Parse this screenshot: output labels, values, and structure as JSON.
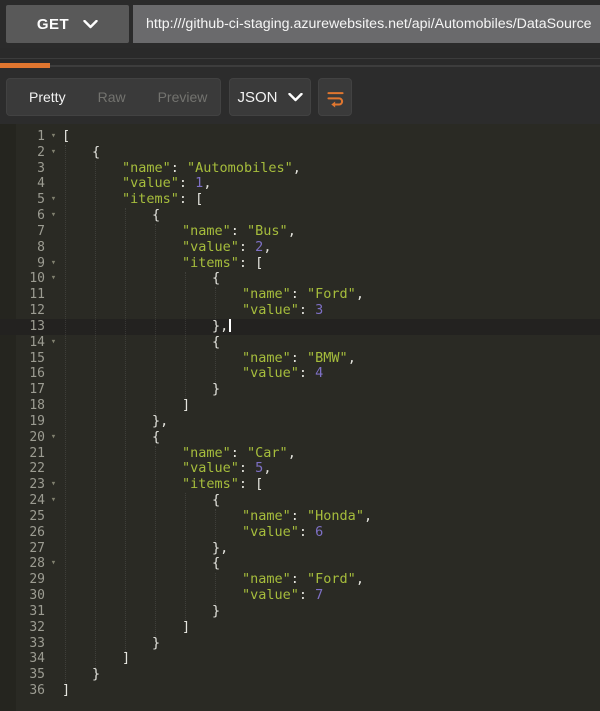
{
  "request_bar": {
    "method": "GET",
    "url": "http:///github-ci-staging.azurewebsites.net/api/Automobiles/DataSource"
  },
  "response_tabs": {
    "pretty": "Pretty",
    "raw": "Raw",
    "preview": "Preview",
    "format": "JSON"
  },
  "colors": {
    "accent_orange": "#e0762f",
    "string_green": "#a6bd3c",
    "number_purple": "#7e70c5",
    "punctuation": "#e4e4de",
    "editor_bg": "#2a2a24",
    "current_line_bg": "#232220",
    "line_number_gray": "#9c9c92"
  },
  "editor": {
    "cursor_line": 13,
    "lines": [
      {
        "n": 1,
        "fold": true,
        "level": 0,
        "tokens": [
          [
            "p",
            "["
          ]
        ]
      },
      {
        "n": 2,
        "fold": true,
        "level": 1,
        "tokens": [
          [
            "p",
            "{"
          ]
        ]
      },
      {
        "n": 3,
        "fold": false,
        "level": 2,
        "tokens": [
          [
            "g",
            "\"name\""
          ],
          [
            "p",
            ": "
          ],
          [
            "g",
            "\"Automobiles\""
          ],
          [
            "p",
            ","
          ]
        ]
      },
      {
        "n": 4,
        "fold": false,
        "level": 2,
        "tokens": [
          [
            "g",
            "\"value\""
          ],
          [
            "p",
            ": "
          ],
          [
            "n",
            "1"
          ],
          [
            "p",
            ","
          ]
        ]
      },
      {
        "n": 5,
        "fold": true,
        "level": 2,
        "tokens": [
          [
            "g",
            "\"items\""
          ],
          [
            "p",
            ": ["
          ]
        ]
      },
      {
        "n": 6,
        "fold": true,
        "level": 3,
        "tokens": [
          [
            "p",
            "{"
          ]
        ]
      },
      {
        "n": 7,
        "fold": false,
        "level": 4,
        "tokens": [
          [
            "g",
            "\"name\""
          ],
          [
            "p",
            ": "
          ],
          [
            "g",
            "\"Bus\""
          ],
          [
            "p",
            ","
          ]
        ]
      },
      {
        "n": 8,
        "fold": false,
        "level": 4,
        "tokens": [
          [
            "g",
            "\"value\""
          ],
          [
            "p",
            ": "
          ],
          [
            "n",
            "2"
          ],
          [
            "p",
            ","
          ]
        ]
      },
      {
        "n": 9,
        "fold": true,
        "level": 4,
        "tokens": [
          [
            "g",
            "\"items\""
          ],
          [
            "p",
            ": ["
          ]
        ]
      },
      {
        "n": 10,
        "fold": true,
        "level": 5,
        "tokens": [
          [
            "p",
            "{"
          ]
        ]
      },
      {
        "n": 11,
        "fold": false,
        "level": 6,
        "tokens": [
          [
            "g",
            "\"name\""
          ],
          [
            "p",
            ": "
          ],
          [
            "g",
            "\"Ford\""
          ],
          [
            "p",
            ","
          ]
        ]
      },
      {
        "n": 12,
        "fold": false,
        "level": 6,
        "tokens": [
          [
            "g",
            "\"value\""
          ],
          [
            "p",
            ": "
          ],
          [
            "n",
            "3"
          ]
        ]
      },
      {
        "n": 13,
        "fold": false,
        "level": 5,
        "tokens": [
          [
            "p",
            "},"
          ]
        ]
      },
      {
        "n": 14,
        "fold": true,
        "level": 5,
        "tokens": [
          [
            "p",
            "{"
          ]
        ]
      },
      {
        "n": 15,
        "fold": false,
        "level": 6,
        "tokens": [
          [
            "g",
            "\"name\""
          ],
          [
            "p",
            ": "
          ],
          [
            "g",
            "\"BMW\""
          ],
          [
            "p",
            ","
          ]
        ]
      },
      {
        "n": 16,
        "fold": false,
        "level": 6,
        "tokens": [
          [
            "g",
            "\"value\""
          ],
          [
            "p",
            ": "
          ],
          [
            "n",
            "4"
          ]
        ]
      },
      {
        "n": 17,
        "fold": false,
        "level": 5,
        "tokens": [
          [
            "p",
            "}"
          ]
        ]
      },
      {
        "n": 18,
        "fold": false,
        "level": 4,
        "tokens": [
          [
            "p",
            "]"
          ]
        ]
      },
      {
        "n": 19,
        "fold": false,
        "level": 3,
        "tokens": [
          [
            "p",
            "},"
          ]
        ]
      },
      {
        "n": 20,
        "fold": true,
        "level": 3,
        "tokens": [
          [
            "p",
            "{"
          ]
        ]
      },
      {
        "n": 21,
        "fold": false,
        "level": 4,
        "tokens": [
          [
            "g",
            "\"name\""
          ],
          [
            "p",
            ": "
          ],
          [
            "g",
            "\"Car\""
          ],
          [
            "p",
            ","
          ]
        ]
      },
      {
        "n": 22,
        "fold": false,
        "level": 4,
        "tokens": [
          [
            "g",
            "\"value\""
          ],
          [
            "p",
            ": "
          ],
          [
            "n",
            "5"
          ],
          [
            "p",
            ","
          ]
        ]
      },
      {
        "n": 23,
        "fold": true,
        "level": 4,
        "tokens": [
          [
            "g",
            "\"items\""
          ],
          [
            "p",
            ": ["
          ]
        ]
      },
      {
        "n": 24,
        "fold": true,
        "level": 5,
        "tokens": [
          [
            "p",
            "{"
          ]
        ]
      },
      {
        "n": 25,
        "fold": false,
        "level": 6,
        "tokens": [
          [
            "g",
            "\"name\""
          ],
          [
            "p",
            ": "
          ],
          [
            "g",
            "\"Honda\""
          ],
          [
            "p",
            ","
          ]
        ]
      },
      {
        "n": 26,
        "fold": false,
        "level": 6,
        "tokens": [
          [
            "g",
            "\"value\""
          ],
          [
            "p",
            ": "
          ],
          [
            "n",
            "6"
          ]
        ]
      },
      {
        "n": 27,
        "fold": false,
        "level": 5,
        "tokens": [
          [
            "p",
            "},"
          ]
        ]
      },
      {
        "n": 28,
        "fold": true,
        "level": 5,
        "tokens": [
          [
            "p",
            "{"
          ]
        ]
      },
      {
        "n": 29,
        "fold": false,
        "level": 6,
        "tokens": [
          [
            "g",
            "\"name\""
          ],
          [
            "p",
            ": "
          ],
          [
            "g",
            "\"Ford\""
          ],
          [
            "p",
            ","
          ]
        ]
      },
      {
        "n": 30,
        "fold": false,
        "level": 6,
        "tokens": [
          [
            "g",
            "\"value\""
          ],
          [
            "p",
            ": "
          ],
          [
            "n",
            "7"
          ]
        ]
      },
      {
        "n": 31,
        "fold": false,
        "level": 5,
        "tokens": [
          [
            "p",
            "}"
          ]
        ]
      },
      {
        "n": 32,
        "fold": false,
        "level": 4,
        "tokens": [
          [
            "p",
            "]"
          ]
        ]
      },
      {
        "n": 33,
        "fold": false,
        "level": 3,
        "tokens": [
          [
            "p",
            "}"
          ]
        ]
      },
      {
        "n": 34,
        "fold": false,
        "level": 2,
        "tokens": [
          [
            "p",
            "]"
          ]
        ]
      },
      {
        "n": 35,
        "fold": false,
        "level": 1,
        "tokens": [
          [
            "p",
            "}"
          ]
        ]
      },
      {
        "n": 36,
        "fold": false,
        "level": 0,
        "tokens": [
          [
            "p",
            "]"
          ]
        ]
      }
    ],
    "guides": [
      {
        "level": 0,
        "from": 2,
        "to": 35
      },
      {
        "level": 1,
        "from": 3,
        "to": 34
      },
      {
        "level": 2,
        "from": 6,
        "to": 33
      },
      {
        "level": 3,
        "from": 7,
        "to": 18
      },
      {
        "level": 3,
        "from": 21,
        "to": 32
      },
      {
        "level": 4,
        "from": 10,
        "to": 17
      },
      {
        "level": 4,
        "from": 24,
        "to": 31
      },
      {
        "level": 5,
        "from": 11,
        "to": 12
      },
      {
        "level": 5,
        "from": 15,
        "to": 16
      },
      {
        "level": 5,
        "from": 25,
        "to": 26
      },
      {
        "level": 5,
        "from": 29,
        "to": 30
      }
    ]
  }
}
